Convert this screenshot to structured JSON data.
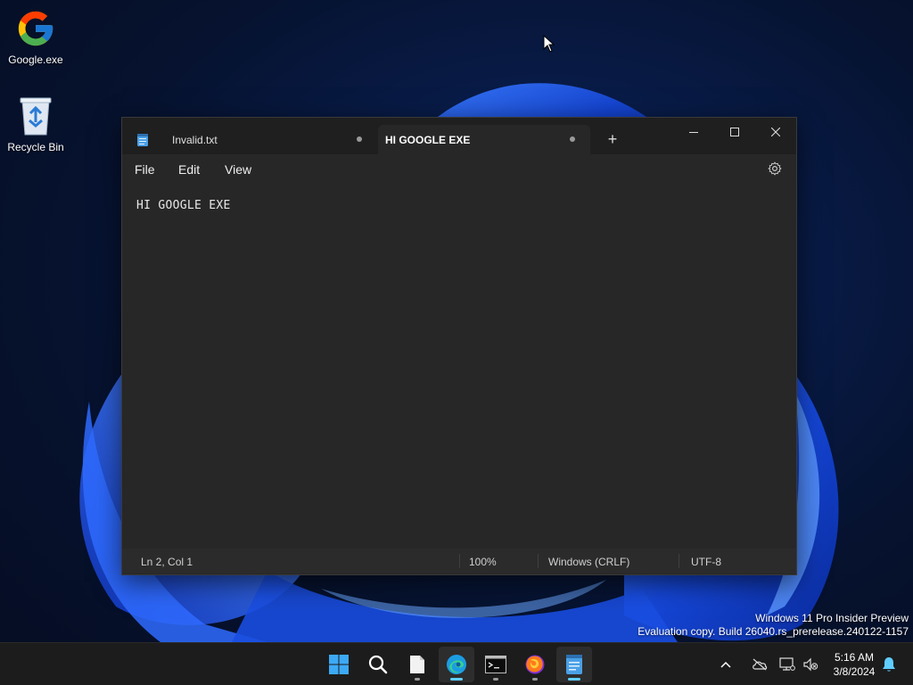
{
  "desktop": {
    "icons": [
      {
        "label": "Google.exe"
      },
      {
        "label": "Recycle Bin"
      }
    ],
    "watermark": {
      "line1": "Windows 11 Pro Insider Preview",
      "line2": "Evaluation copy. Build 26040.rs_prerelease.240122-1157"
    }
  },
  "notepad": {
    "tabs": [
      {
        "label": "Invalid.txt",
        "unsaved": true
      },
      {
        "label": "HI GOOGLE EXE",
        "unsaved": true,
        "active": true
      }
    ],
    "new_tab_label": "+",
    "menu": {
      "file": "File",
      "edit": "Edit",
      "view": "View"
    },
    "content": "HI GOOGLE EXE",
    "status": {
      "position": "Ln 2, Col 1",
      "zoom": "100%",
      "line_ending": "Windows (CRLF)",
      "encoding": "UTF-8"
    }
  },
  "taskbar": {
    "apps": [
      "start-icon",
      "search-icon",
      "file-explorer-icon",
      "edge-icon",
      "terminal-icon",
      "firefox-icon",
      "notepad-icon"
    ],
    "clock": {
      "time": "5:16 AM",
      "date": "3/8/2024"
    }
  },
  "colors": {
    "accent": "#60cdff",
    "window_bg": "#272727",
    "titlebar_bg": "#1f1f1f",
    "taskbar_bg": "#1c1c1c"
  }
}
